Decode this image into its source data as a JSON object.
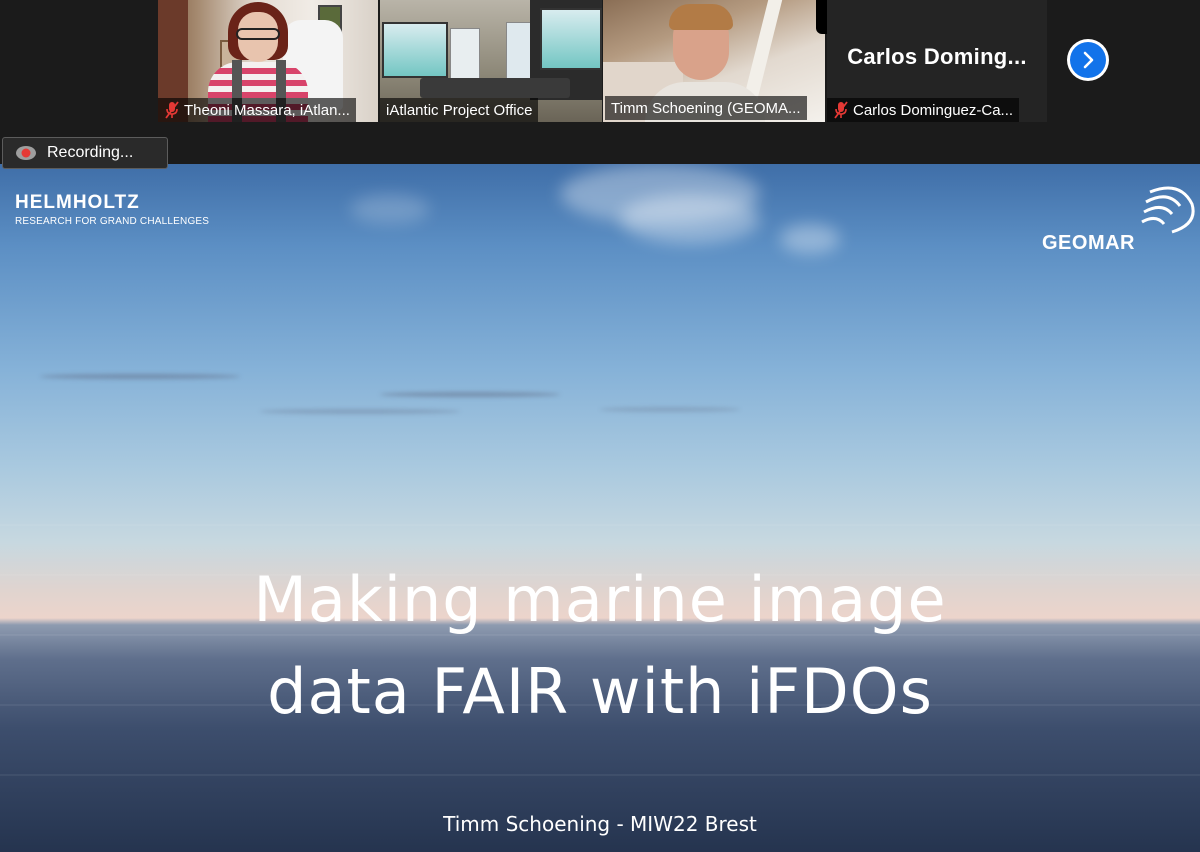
{
  "participants": [
    {
      "name": "Theoni Massara, iAtlan...",
      "muted": true
    },
    {
      "name": "iAtlantic Project Office",
      "muted": false
    },
    {
      "name": "Timm Schoening (GEOMA...",
      "muted": false,
      "active_speaker": true
    },
    {
      "name": "Carlos Dominguez-Ca...",
      "muted": true,
      "display_title": "Carlos  Doming...",
      "video_off": true
    }
  ],
  "recording": {
    "label": "Recording..."
  },
  "next_page_icon": "chevron-right-icon",
  "slide": {
    "logo_left": {
      "wordmark": "HELMHOLTZ",
      "tagline": "RESEARCH FOR GRAND CHALLENGES"
    },
    "logo_right": {
      "wordmark": "GEOMAR"
    },
    "title_line1": "Making marine image",
    "title_line2": "data FAIR with iFDOs",
    "footer": "Timm Schoening - MIW22 Brest"
  },
  "colors": {
    "active_speaker_border": "#8fce2f",
    "next_button": "#1273ea",
    "mute_icon": "#e53935",
    "record_dot": "#e53935"
  }
}
